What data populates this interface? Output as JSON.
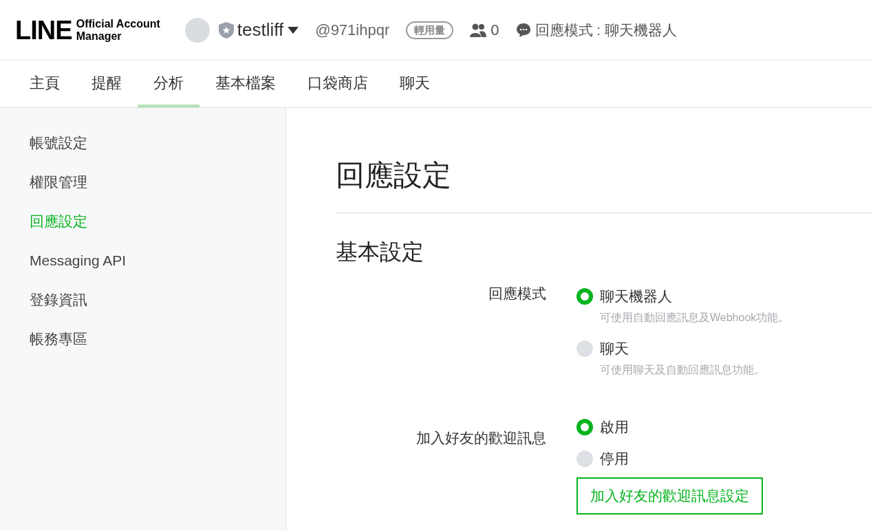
{
  "header": {
    "logo": {
      "wordmark": "LINE",
      "subtitle": [
        "Official Account",
        "Manager"
      ]
    },
    "account_name": "testliff",
    "account_id": "@971ihpqr",
    "plan_badge": "輕用量",
    "friends_count": "0",
    "response_mode": "回應模式 : 聊天機器人"
  },
  "tabs": [
    {
      "label": "主頁",
      "selected": false
    },
    {
      "label": "提醒",
      "selected": false
    },
    {
      "label": "分析",
      "selected": true
    },
    {
      "label": "基本檔案",
      "selected": false
    },
    {
      "label": "口袋商店",
      "selected": false
    },
    {
      "label": "聊天",
      "selected": false
    }
  ],
  "sidebar": {
    "items": [
      {
        "label": "帳號設定",
        "selected": false
      },
      {
        "label": "權限管理",
        "selected": false
      },
      {
        "label": "回應設定",
        "selected": true
      },
      {
        "label": "Messaging API",
        "selected": false
      },
      {
        "label": "登錄資訊",
        "selected": false
      },
      {
        "label": "帳務專區",
        "selected": false
      }
    ]
  },
  "page_title": "回應設定",
  "section_title": "基本設定",
  "settings": [
    {
      "label": "回應模式",
      "options": [
        {
          "label": "聊天機器人",
          "description": "可使用自動回應訊息及Webhook功能。",
          "selected": true
        },
        {
          "label": "聊天",
          "description": "可使用聊天及自動回應訊息功能。",
          "selected": false
        }
      ]
    },
    {
      "label": "加入好友的歡迎訊息",
      "options": [
        {
          "label": "啟用",
          "selected": true
        },
        {
          "label": "停用",
          "selected": false
        }
      ],
      "button": "加入好友的歡迎訊息設定"
    }
  ]
}
